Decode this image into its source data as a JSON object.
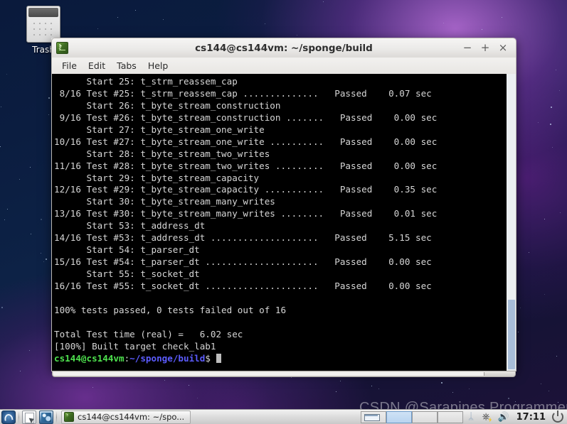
{
  "desktop": {
    "icons": [
      {
        "name": "trash-icon",
        "label": "Trash"
      }
    ]
  },
  "window": {
    "title": "cs144@cs144vm: ~/sponge/build",
    "icon": "terminal-icon",
    "controls": {
      "minimize": "−",
      "maximize": "+",
      "close": "×"
    },
    "menu": [
      "File",
      "Edit",
      "Tabs",
      "Help"
    ]
  },
  "terminal": {
    "lines": [
      "      Start 25: t_strm_reassem_cap",
      " 8/16 Test #25: t_strm_reassem_cap ..............   Passed    0.07 sec",
      "      Start 26: t_byte_stream_construction",
      " 9/16 Test #26: t_byte_stream_construction .......   Passed    0.00 sec",
      "      Start 27: t_byte_stream_one_write",
      "10/16 Test #27: t_byte_stream_one_write ..........   Passed    0.00 sec",
      "      Start 28: t_byte_stream_two_writes",
      "11/16 Test #28: t_byte_stream_two_writes .........   Passed    0.00 sec",
      "      Start 29: t_byte_stream_capacity",
      "12/16 Test #29: t_byte_stream_capacity ...........   Passed    0.35 sec",
      "      Start 30: t_byte_stream_many_writes",
      "13/16 Test #30: t_byte_stream_many_writes ........   Passed    0.01 sec",
      "      Start 53: t_address_dt",
      "14/16 Test #53: t_address_dt ....................   Passed    5.15 sec",
      "      Start 54: t_parser_dt",
      "15/16 Test #54: t_parser_dt .....................   Passed    0.00 sec",
      "      Start 55: t_socket_dt",
      "16/16 Test #55: t_socket_dt .....................   Passed    0.00 sec",
      "",
      "100% tests passed, 0 tests failed out of 16",
      "",
      "Total Test time (real) =   6.02 sec",
      "[100%] Built target check_lab1"
    ],
    "prompt": {
      "user_host": "cs144@cs144vm",
      "separator": ":",
      "path": "~/sponge/build",
      "sigil": "$",
      "colors": {
        "user_host": "#4ee24e",
        "path": "#5c5cff",
        "text": "#d6d6d6",
        "background": "#000000"
      }
    }
  },
  "watermark": {
    "text": "CSDN @Sarapines Programmer"
  },
  "taskbar": {
    "launchers": [
      {
        "name": "menu-icon"
      },
      {
        "name": "file-manager-icon"
      },
      {
        "name": "web-browser-icon"
      }
    ],
    "tasks": [
      {
        "label": "cs144@cs144vm: ~/spo...",
        "icon": "terminal-icon"
      }
    ],
    "tray": {
      "bluetooth": "ᛦ",
      "network": "⎈",
      "volume": "ὐA",
      "clock": "17:11",
      "power": "power-icon"
    }
  }
}
